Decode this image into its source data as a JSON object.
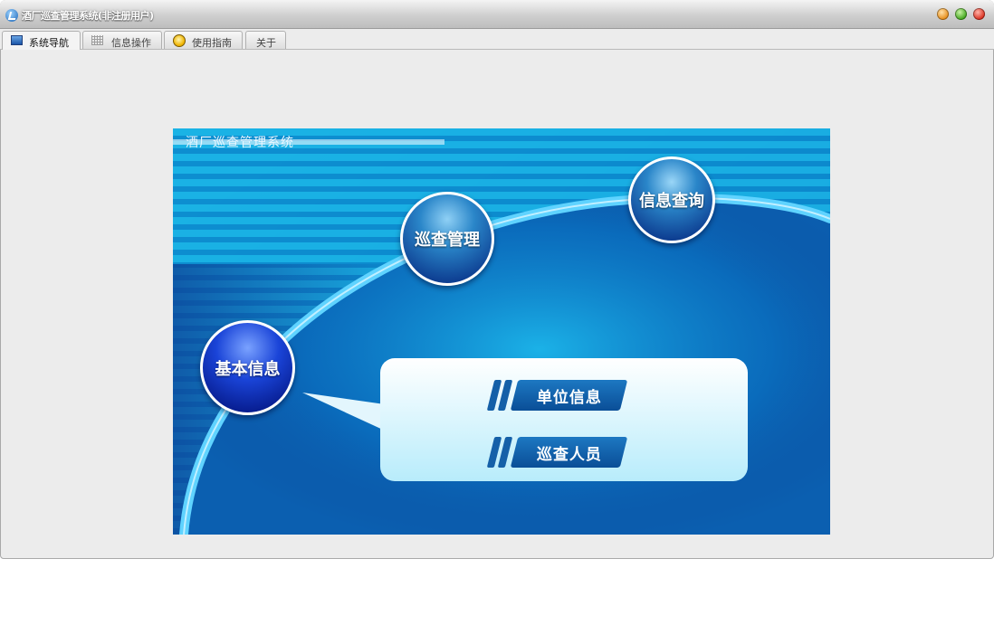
{
  "window": {
    "title": "酒厂巡查管理系统(非注册用户)"
  },
  "window_controls": [
    "minimize",
    "maximize",
    "close"
  ],
  "tabs": [
    {
      "label": "系统导航",
      "icon": "monitor-icon",
      "active": true
    },
    {
      "label": "信息操作",
      "icon": "grid-icon",
      "active": false
    },
    {
      "label": "使用指南",
      "icon": "lightbulb-icon",
      "active": false
    },
    {
      "label": "关于",
      "icon": "",
      "active": false
    }
  ],
  "banner": {
    "title": "酒厂巡查管理系统",
    "nodes": {
      "basic_info": "基本信息",
      "patrol_mgmt": "巡查管理",
      "info_query": "信息查询"
    },
    "submenu": [
      {
        "label": "单位信息"
      },
      {
        "label": "巡查人员"
      }
    ]
  },
  "colors": {
    "banner_dark": "#0b3e8e",
    "banner_light": "#1fb8e8",
    "arc": "#5fd3ff",
    "callout_fill": "#eaf9ff",
    "button_blue": "#0a4e97"
  }
}
